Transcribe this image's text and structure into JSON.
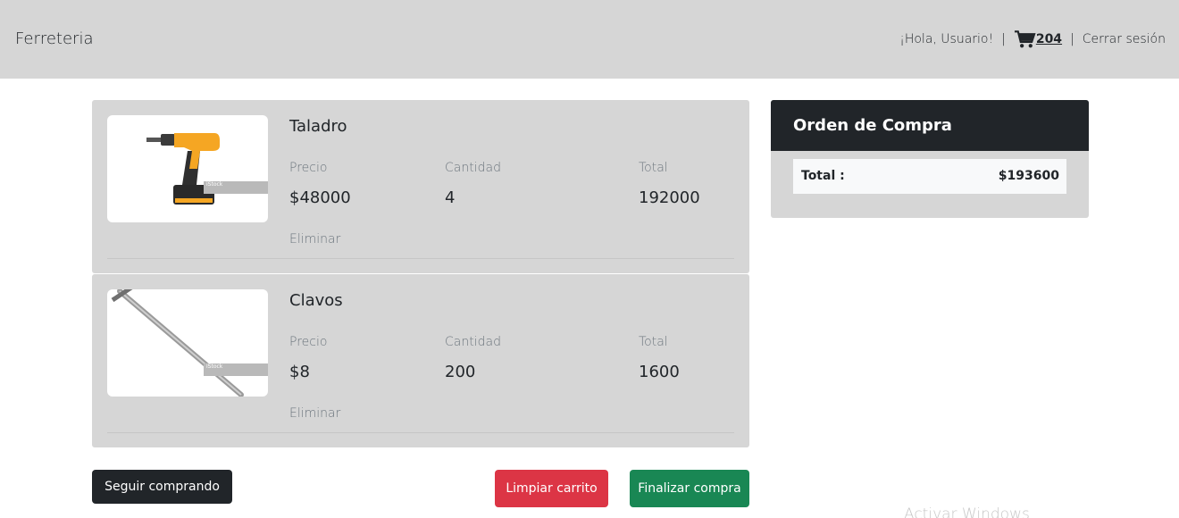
{
  "navbar": {
    "brand": "Ferreteria",
    "greeting": "¡Hola, Usuario!",
    "separator": "|",
    "cart_icon": "cart-icon",
    "cart_count": "204",
    "logout": "Cerrar sesión"
  },
  "cart": {
    "items": [
      {
        "name": "Taladro",
        "price_label": "Precio",
        "price": "$48000",
        "qty_label": "Cantidad",
        "qty": "4",
        "total_label": "Total",
        "total": "192000",
        "remove": "Eliminar",
        "image_caption": "iStock"
      },
      {
        "name": "Clavos",
        "price_label": "Precio",
        "price": "$8",
        "qty_label": "Cantidad",
        "qty": "200",
        "total_label": "Total",
        "total": "1600",
        "remove": "Eliminar",
        "image_caption": "iStock"
      }
    ]
  },
  "order": {
    "title": "Orden de Compra",
    "total_label": "Total :",
    "total_value": "$193600"
  },
  "actions": {
    "continue": "Seguir comprando",
    "clear": "Limpiar carrito",
    "checkout": "Finalizar compra"
  },
  "watermark": "Activar Windows",
  "colors": {
    "navbar_bg": "#d6d6d6",
    "dark": "#212529",
    "danger": "#dc3545",
    "success": "#198754"
  }
}
